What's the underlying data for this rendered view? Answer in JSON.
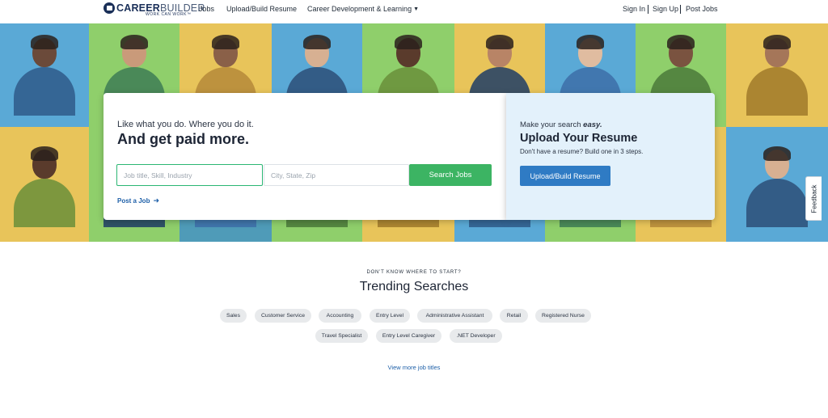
{
  "header": {
    "logo_text_bold": "CAREER",
    "logo_text_thin": "BUILDER",
    "logo_tagline": "WORK CAN WORK™",
    "nav": {
      "jobs": "Jobs",
      "resume": "Upload/Build Resume",
      "career": "Career Development & Learning"
    },
    "auth": {
      "sign_in": "Sign In",
      "sign_up": "Sign Up",
      "post_jobs": "Post Jobs"
    }
  },
  "hero": {
    "search": {
      "tagline": "Like what you do. Where you do it.",
      "headline": "And get paid more.",
      "job_placeholder": "Job title, Skill, Industry",
      "location_placeholder": "City, State, Zip",
      "search_button": "Search Jobs",
      "post_job_link": "Post a Job"
    },
    "upload": {
      "kicker_prefix": "Make your search ",
      "kicker_emphasis": "easy.",
      "title": "Upload Your Resume",
      "subtitle": "Don't have a resume? Build one in 3 steps.",
      "button": "Upload/Build Resume"
    },
    "tile_colors": {
      "blue": "#5aa9d6",
      "green": "#8fcf6b",
      "yellow": "#e8c45a",
      "teal": "#4f9bb8"
    }
  },
  "feedback_label": "Feedback",
  "trending": {
    "kicker": "DON'T KNOW WHERE TO START?",
    "title": "Trending Searches",
    "row1": [
      "Sales",
      "Customer Service",
      "Accounting",
      "Entry Level",
      "Administrative Assistant",
      "Retail",
      "Registered Nurse"
    ],
    "row2": [
      "Travel Specialist",
      "Entry Level Caregiver",
      ".NET Developer"
    ],
    "view_more": "View more job titles"
  },
  "colors": {
    "accent_green": "#3cb463",
    "accent_blue": "#2f7bc4",
    "link_blue": "#1d5fa8",
    "brand_navy": "#1a2f58"
  }
}
